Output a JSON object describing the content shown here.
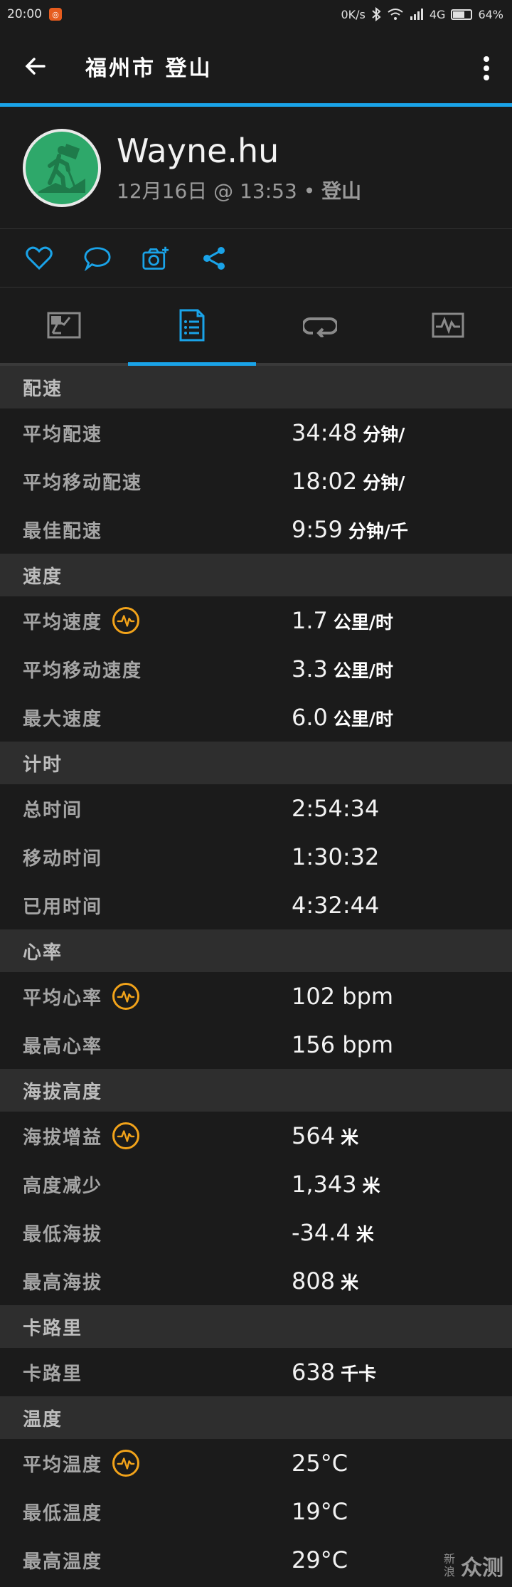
{
  "status": {
    "time": "20:00",
    "net_speed": "0K/s",
    "network": "4G",
    "battery": "64%",
    "battery_level": 0.64
  },
  "appbar": {
    "title": "福州市 登山"
  },
  "profile": {
    "name": "Wayne.hu",
    "date": "12月16日",
    "at": "@",
    "time": "13:53",
    "sep": "•",
    "activity": "登山"
  },
  "icons": {
    "back": "arrow-left-icon",
    "more": "more-vertical-icon",
    "like": "heart-icon",
    "comment": "comment-icon",
    "camera": "camera-add-icon",
    "share": "share-icon",
    "tab1": "map-icon",
    "tab2": "stats-list-icon",
    "tab3": "laps-icon",
    "tab4": "chart-icon",
    "badge": "performance-pulse-icon"
  },
  "colors": {
    "accent": "#1aa3e8",
    "badge": "#f2a31a",
    "avatar": "#2ea86a"
  },
  "sections": [
    {
      "title": "配速",
      "rows": [
        {
          "label": "平均配速",
          "value": "34:48",
          "unit": "分钟/"
        },
        {
          "label": "平均移动配速",
          "value": "18:02",
          "unit": "分钟/"
        },
        {
          "label": "最佳配速",
          "value": "9:59",
          "unit": "分钟/千"
        }
      ]
    },
    {
      "title": "速度",
      "rows": [
        {
          "label": "平均速度",
          "value": "1.7",
          "unit": "公里/时",
          "badge": true
        },
        {
          "label": "平均移动速度",
          "value": "3.3",
          "unit": "公里/时"
        },
        {
          "label": "最大速度",
          "value": "6.0",
          "unit": "公里/时"
        }
      ]
    },
    {
      "title": "计时",
      "rows": [
        {
          "label": "总时间",
          "value": "2:54:34",
          "unit": ""
        },
        {
          "label": "移动时间",
          "value": "1:30:32",
          "unit": ""
        },
        {
          "label": "已用时间",
          "value": "4:32:44",
          "unit": ""
        }
      ]
    },
    {
      "title": "心率",
      "rows": [
        {
          "label": "平均心率",
          "value": "102 bpm",
          "unit": "",
          "badge": true
        },
        {
          "label": "最高心率",
          "value": "156 bpm",
          "unit": ""
        }
      ]
    },
    {
      "title": "海拔高度",
      "rows": [
        {
          "label": "海拔增益",
          "value": "564",
          "unit": "米",
          "badge": true
        },
        {
          "label": "高度减少",
          "value": "1,343",
          "unit": "米"
        },
        {
          "label": "最低海拔",
          "value": "-34.4",
          "unit": "米"
        },
        {
          "label": "最高海拔",
          "value": "808",
          "unit": "米"
        }
      ]
    },
    {
      "title": "卡路里",
      "rows": [
        {
          "label": "卡路里",
          "value": "638",
          "unit": "千卡"
        }
      ]
    },
    {
      "title": "温度",
      "rows": [
        {
          "label": "平均温度",
          "value": "25°C",
          "unit": "",
          "badge": true
        },
        {
          "label": "最低温度",
          "value": "19°C",
          "unit": ""
        },
        {
          "label": "最高温度",
          "value": "29°C",
          "unit": ""
        }
      ]
    }
  ],
  "watermark": {
    "small": "新浪",
    "big": "众测"
  }
}
